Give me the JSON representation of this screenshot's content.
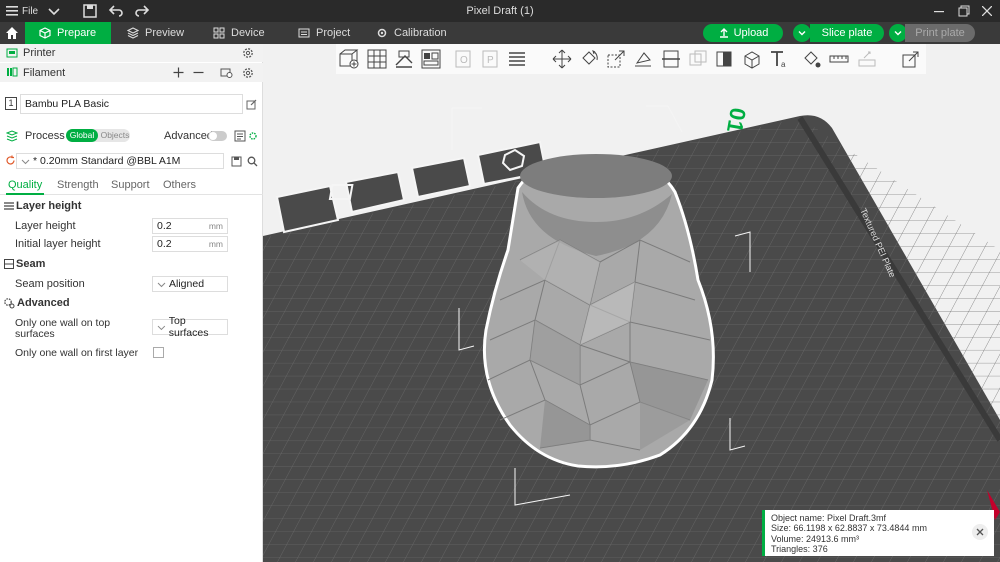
{
  "titlebar": {
    "file_label": "File",
    "title": "Pixel Draft (1)"
  },
  "tabs": [
    {
      "label": "Prepare"
    },
    {
      "label": "Preview"
    },
    {
      "label": "Device"
    },
    {
      "label": "Project"
    },
    {
      "label": "Calibration"
    }
  ],
  "actions": {
    "upload": "Upload",
    "slice": "Slice plate",
    "print": "Print plate"
  },
  "left": {
    "printer_label": "Printer",
    "filament_label": "Filament",
    "filament_slot": "1",
    "filament_name": "Bambu PLA Basic",
    "process_label": "Process",
    "global_label": "Global",
    "objects_label": "Objects",
    "advanced_label": "Advanced",
    "preset_name": "* 0.20mm Standard @BBL A1M",
    "subtabs": [
      "Quality",
      "Strength",
      "Support",
      "Others"
    ],
    "layer_height_header": "Layer height",
    "layer_height_label": "Layer height",
    "layer_height_value": "0.2",
    "initial_layer_label": "Initial layer height",
    "initial_layer_value": "0.2",
    "unit": "mm",
    "seam_header": "Seam",
    "seam_position_label": "Seam position",
    "seam_position_value": "Aligned",
    "advanced_header": "Advanced",
    "one_wall_top_label_1": "Only one wall on top",
    "one_wall_top_label_2": "surfaces",
    "one_wall_top_value": "Top surfaces",
    "one_wall_first_label": "Only one wall on first layer"
  },
  "plate": {
    "number": "01",
    "label": "Textured PEI Plate"
  },
  "object_info": {
    "name_line": "Object name: Pixel Draft.3mf",
    "size_line": "Size: 66.1198 x 62.8837 x 73.4844 mm",
    "volume_line": "Volume: 24913.6 mm³",
    "triangles_line": "Triangles: 376"
  },
  "colors": {
    "accent": "#00ae42",
    "plate": "#4a4a4a",
    "titlebar": "#2a2a2a",
    "tabbar": "#3a3a3a"
  },
  "icons": {
    "tools": [
      "add-icon",
      "arrange-grid-icon",
      "orient-icon",
      "auto-arrange-icon",
      "split-objects-icon",
      "split-parts-icon",
      "layers-icon",
      "move-icon",
      "rotate-icon",
      "scale-icon",
      "lay-on-face-icon",
      "cut-icon",
      "mesh-boolean-icon",
      "support-paint-icon",
      "seam-paint-icon",
      "text-icon",
      "color-paint-icon",
      "measure-icon",
      "assembly-icon",
      "settings-icon"
    ]
  }
}
